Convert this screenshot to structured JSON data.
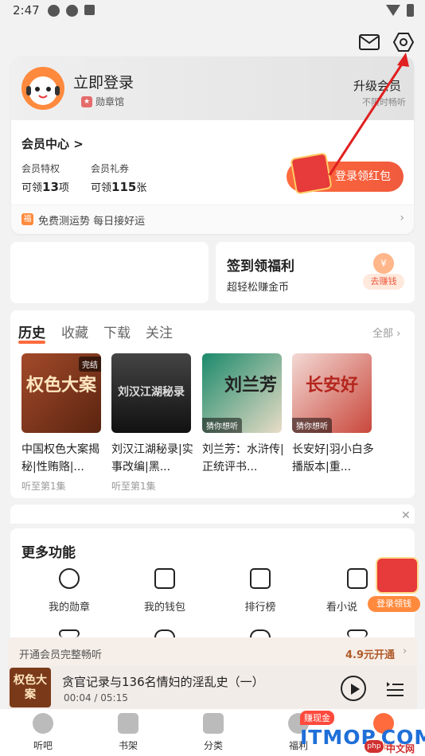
{
  "status_bar": {
    "time": "2:47"
  },
  "profile": {
    "login": "立即登录",
    "badge_hall": "勋章馆",
    "upgrade_title": "升级会员",
    "upgrade_sub": "不限时畅听"
  },
  "member": {
    "center": "会员中心 >",
    "privilege_label": "会员特权",
    "privilege_prefix": "可领",
    "privilege_count": "13",
    "privilege_unit": "项",
    "gift_label": "会员礼券",
    "gift_prefix": "可领",
    "gift_count": "115",
    "gift_unit": "张",
    "redpack_button": "登录领红包",
    "fortune_icon": "福",
    "fortune_text": "免费测运势 每日接好运"
  },
  "signin": {
    "title": "签到领福利",
    "subtitle": "超轻松赚金币",
    "earn_button": "去赚钱"
  },
  "history": {
    "tabs": [
      "历史",
      "收藏",
      "下载",
      "关注"
    ],
    "all_link": "全部",
    "books": [
      {
        "cover_title": "权色大案",
        "tag": "完结",
        "title": "中国权色大案揭秘|性贿赂|...",
        "progress": "听至第1集"
      },
      {
        "cover_title": "刘汉江湖秘录",
        "tag": "",
        "title": "刘汉江湖秘录|实事改编|黑...",
        "progress": "听至第1集"
      },
      {
        "cover_title": "刘兰芳",
        "tag": "猜你想听",
        "title": "刘兰芳：水浒传|正统评书...",
        "progress": ""
      },
      {
        "cover_title": "长安好",
        "tag": "猜你想听",
        "title": "长安好|羽小白多播版本|重...",
        "progress": ""
      }
    ]
  },
  "more": {
    "title": "更多功能",
    "items": [
      "我的勋章",
      "我的钱包",
      "排行榜",
      "看小说"
    ],
    "float_button": "登录领钱"
  },
  "vip_bar": {
    "text": "开通会员完整畅听",
    "price": "4.9元开通"
  },
  "player": {
    "title": "贪官记录与136名情妇的淫乱史（一）",
    "time": "00:04 / 05:15",
    "cover_title": "权色大案"
  },
  "nav": {
    "items": [
      "听吧",
      "书架",
      "分类",
      "福利",
      "我的"
    ],
    "earn_badge": "赚现金"
  },
  "watermark": {
    "brand": "ITMOP.COM",
    "sub": "中文网",
    "php": "php"
  },
  "colors": {
    "accent": "#ff6b3d",
    "red": "#e73a3a",
    "annotation": "#e02020"
  }
}
